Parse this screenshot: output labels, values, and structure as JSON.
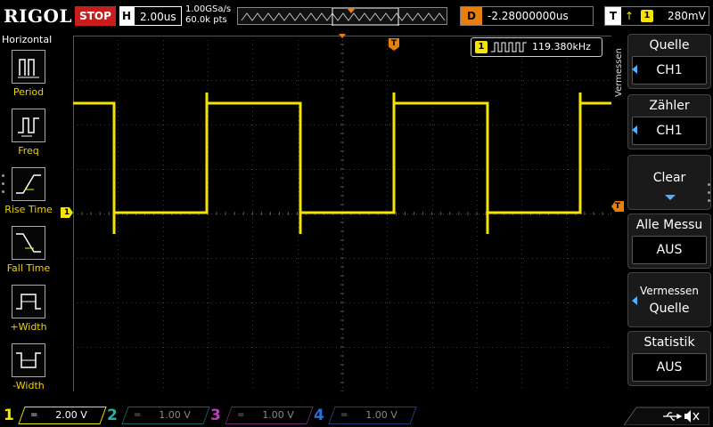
{
  "header": {
    "brand": "RIGOL",
    "run_state": "STOP",
    "timebase_label": "H",
    "timebase_value": "2.00us",
    "sample_rate": "1.00GSa/s",
    "memory_depth": "60.0k pts",
    "delay_label": "D",
    "delay_value": "-2.28000000us",
    "trigger_label": "T",
    "trigger_edge": "↑",
    "trigger_source": "1",
    "trigger_level": "280mV"
  },
  "left_menu": {
    "title": "Horizontal",
    "items": [
      {
        "label": "Period",
        "icon": "period-icon"
      },
      {
        "label": "Freq",
        "icon": "frequency-icon"
      },
      {
        "label": "Rise Time",
        "icon": "rise-time-icon"
      },
      {
        "label": "Fall Time",
        "icon": "fall-time-icon"
      },
      {
        "label": "+Width",
        "icon": "positive-width-icon"
      },
      {
        "label": "-Width",
        "icon": "negative-width-icon"
      }
    ]
  },
  "measurement": {
    "channel": "1",
    "value": "119.380kHz"
  },
  "right_menu": {
    "vertical_title": "Vermessen",
    "items": [
      {
        "label": "Quelle",
        "value": "CH1"
      },
      {
        "label": "Zähler",
        "value": "CH1"
      },
      {
        "label": "Clear",
        "value": ""
      },
      {
        "label": "Alle Messu",
        "value": "AUS"
      },
      {
        "label": "Vermessen",
        "value": "Quelle"
      },
      {
        "label": "Statistik",
        "value": "AUS"
      }
    ]
  },
  "channels": [
    {
      "num": "1",
      "coupling": "=",
      "scale": "2.00 V",
      "color": "#f5e400",
      "active": true
    },
    {
      "num": "2",
      "coupling": "=",
      "scale": "1.00 V",
      "color": "#1fb5a8",
      "active": false
    },
    {
      "num": "3",
      "coupling": "=",
      "scale": "1.00 V",
      "color": "#c23bc2",
      "active": false
    },
    {
      "num": "4",
      "coupling": "=",
      "scale": "1.00 V",
      "color": "#2b6fd6",
      "active": false
    }
  ],
  "markers": {
    "channel1": "1",
    "trigger_pos": "T",
    "trigger_level": "T"
  },
  "colors": {
    "ch1": "#f5e400",
    "trigger": "#e87f0a",
    "accent_blue": "#4fb0ff",
    "stop_red": "#c81e1e"
  }
}
